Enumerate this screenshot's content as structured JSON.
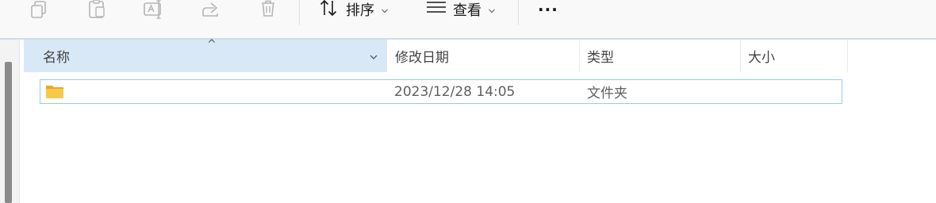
{
  "toolbar": {
    "icons": [
      "copy-icon",
      "paste-icon",
      "rename-icon",
      "share-icon",
      "delete-icon"
    ],
    "sort_label": "排序",
    "view_label": "查看",
    "more_label": "···"
  },
  "columns": {
    "name": "名称",
    "date_modified": "修改日期",
    "type": "类型",
    "size": "大小"
  },
  "rows": [
    {
      "name": "",
      "date_modified": "2023/12/28 14:05",
      "type": "文件夹",
      "size": "",
      "icon": "folder-icon"
    }
  ],
  "colors": {
    "header_selected": "#d9e8f7",
    "row_border": "#99c9ea",
    "folder": "#f5c542"
  }
}
